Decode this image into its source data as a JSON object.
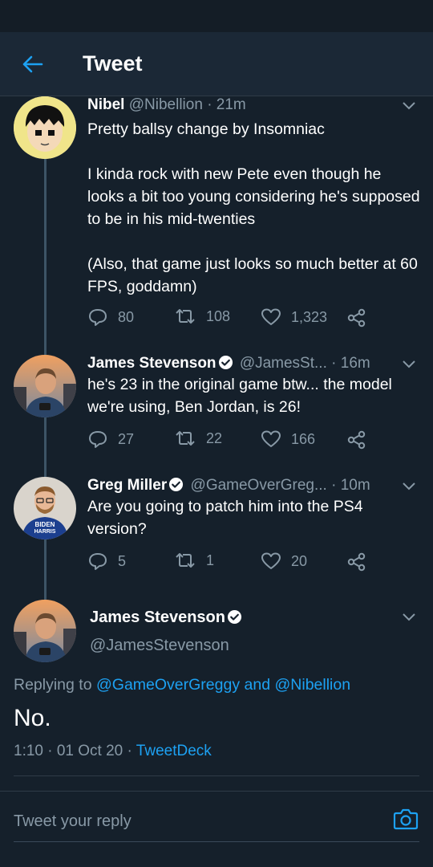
{
  "header": {
    "title": "Tweet",
    "back_icon": "arrow-left-icon"
  },
  "colors": {
    "accent": "#1da1f2",
    "background": "#15202b",
    "muted": "#8899a6"
  },
  "thread": [
    {
      "name": "Nibel",
      "handle": "@Nibellion",
      "time": "· 21m",
      "verified": false,
      "text": "Pretty ballsy change by Insomniac\n\nI kinda rock with new Pete even though he looks a bit too young considering he's supposed to be in his mid-twenties\n\n(Also, that game just looks so much better at 60 FPS, goddamn)",
      "replies": "80",
      "retweets": "108",
      "likes": "1,323"
    },
    {
      "name": "James Stevenson",
      "handle": "@JamesSt...",
      "time": "· 16m",
      "verified": true,
      "text": "he's 23 in the original game btw... the model we're using, Ben Jordan, is 26!",
      "replies": "27",
      "retweets": "22",
      "likes": "166"
    },
    {
      "name": "Greg Miller",
      "handle": "@GameOverGreg...",
      "time": "· 10m",
      "verified": true,
      "avatar_shirt_text_1": "BIDEN",
      "avatar_shirt_text_2": "HARRIS",
      "text": "Are you going to patch him into the PS4 version?",
      "replies": "5",
      "retweets": "1",
      "likes": "20"
    }
  ],
  "focused": {
    "name": "James Stevenson",
    "handle": "@JamesStevenson",
    "verified": true,
    "replying_prefix": "Replying to",
    "replying_user1": "@GameOverGreggy",
    "replying_and": "and",
    "replying_user2": "@Nibellion",
    "text": "No.",
    "timestamp": "1:10 · 01 Oct 20 ·",
    "source": "TweetDeck"
  },
  "reply": {
    "placeholder": "Tweet your reply",
    "camera_icon": "camera-icon"
  }
}
